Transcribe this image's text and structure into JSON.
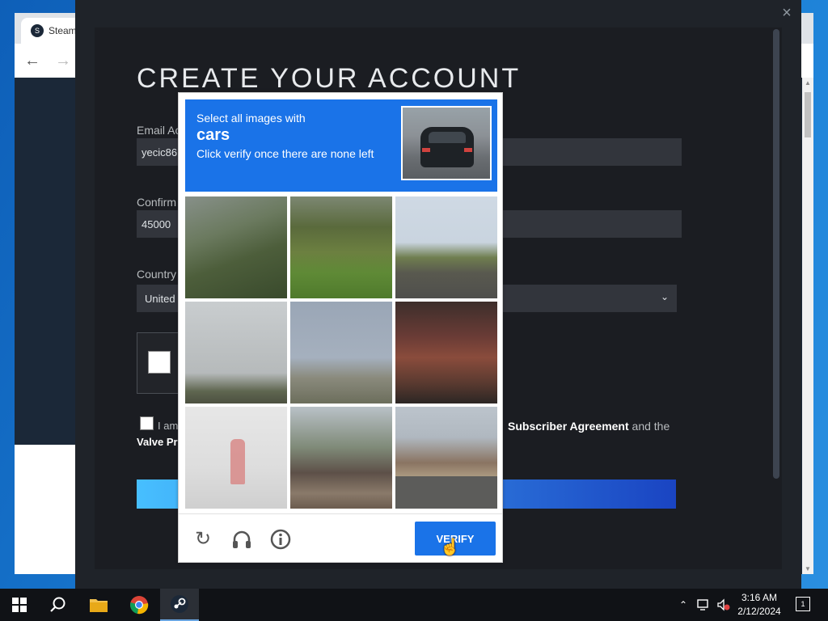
{
  "browser": {
    "tab_title": "Steam",
    "back_icon": "arrow-left-icon",
    "forward_icon": "arrow-right-icon"
  },
  "modal": {
    "close_icon": "close-icon",
    "heading": "CREATE YOUR ACCOUNT",
    "email_label": "Email Ac",
    "email_value": "yecic86",
    "confirm_label": "Confirm",
    "confirm_value": "45000",
    "country_label": "Country",
    "country_value": "United",
    "agree_left": "I am",
    "agree_right_link": "Subscriber Agreement",
    "agree_right_tail": " and the",
    "valve_link": "Valve Pr"
  },
  "recaptcha": {
    "line1": "Select all images with",
    "object": "cars",
    "line3": "Click verify once there are none left",
    "verify_label": "VERIFY",
    "reload_icon": "reload-icon",
    "audio_icon": "headphones-icon",
    "info_icon": "info-icon"
  },
  "taskbar": {
    "start_icon": "windows-start-icon",
    "search_icon": "search-icon",
    "explorer_icon": "folder-icon",
    "chrome_icon": "chrome-icon",
    "steam_icon": "steam-icon",
    "time": "3:16 AM",
    "date": "2/12/2024",
    "notifications": "1"
  }
}
